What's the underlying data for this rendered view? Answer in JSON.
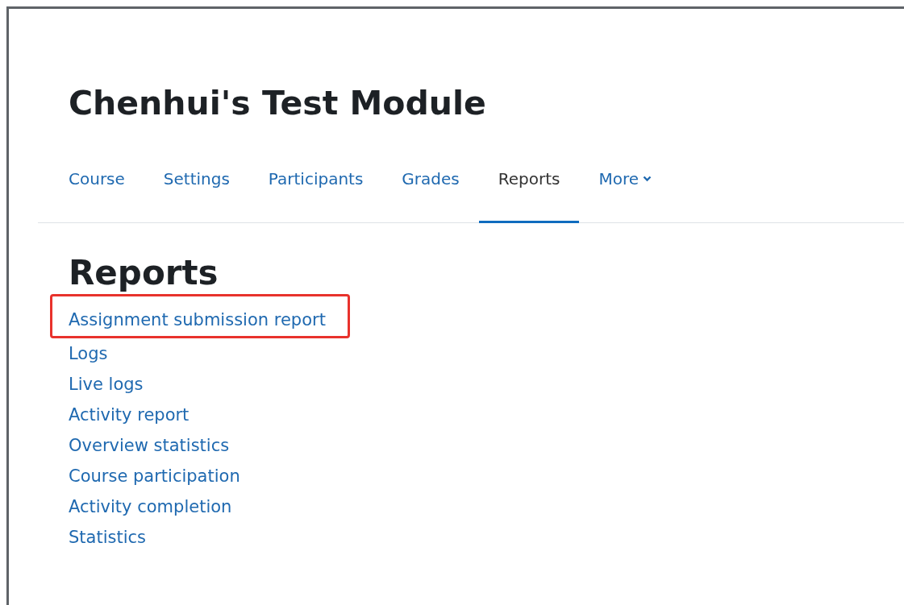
{
  "course_title": "Chenhui's Test Module",
  "tabs": [
    {
      "label": "Course",
      "selected": false
    },
    {
      "label": "Settings",
      "selected": false
    },
    {
      "label": "Participants",
      "selected": false
    },
    {
      "label": "Grades",
      "selected": false
    },
    {
      "label": "Reports",
      "selected": true
    },
    {
      "label": "More",
      "selected": false,
      "dropdown": true
    }
  ],
  "heading": "Reports",
  "links": [
    {
      "label": "Assignment submission report",
      "highlighted": true
    },
    {
      "label": "Logs",
      "highlighted": false
    },
    {
      "label": "Live logs",
      "highlighted": false
    },
    {
      "label": "Activity report",
      "highlighted": false
    },
    {
      "label": "Overview statistics",
      "highlighted": false
    },
    {
      "label": "Course participation",
      "highlighted": false
    },
    {
      "label": "Activity completion",
      "highlighted": false
    },
    {
      "label": "Statistics",
      "highlighted": false
    }
  ]
}
